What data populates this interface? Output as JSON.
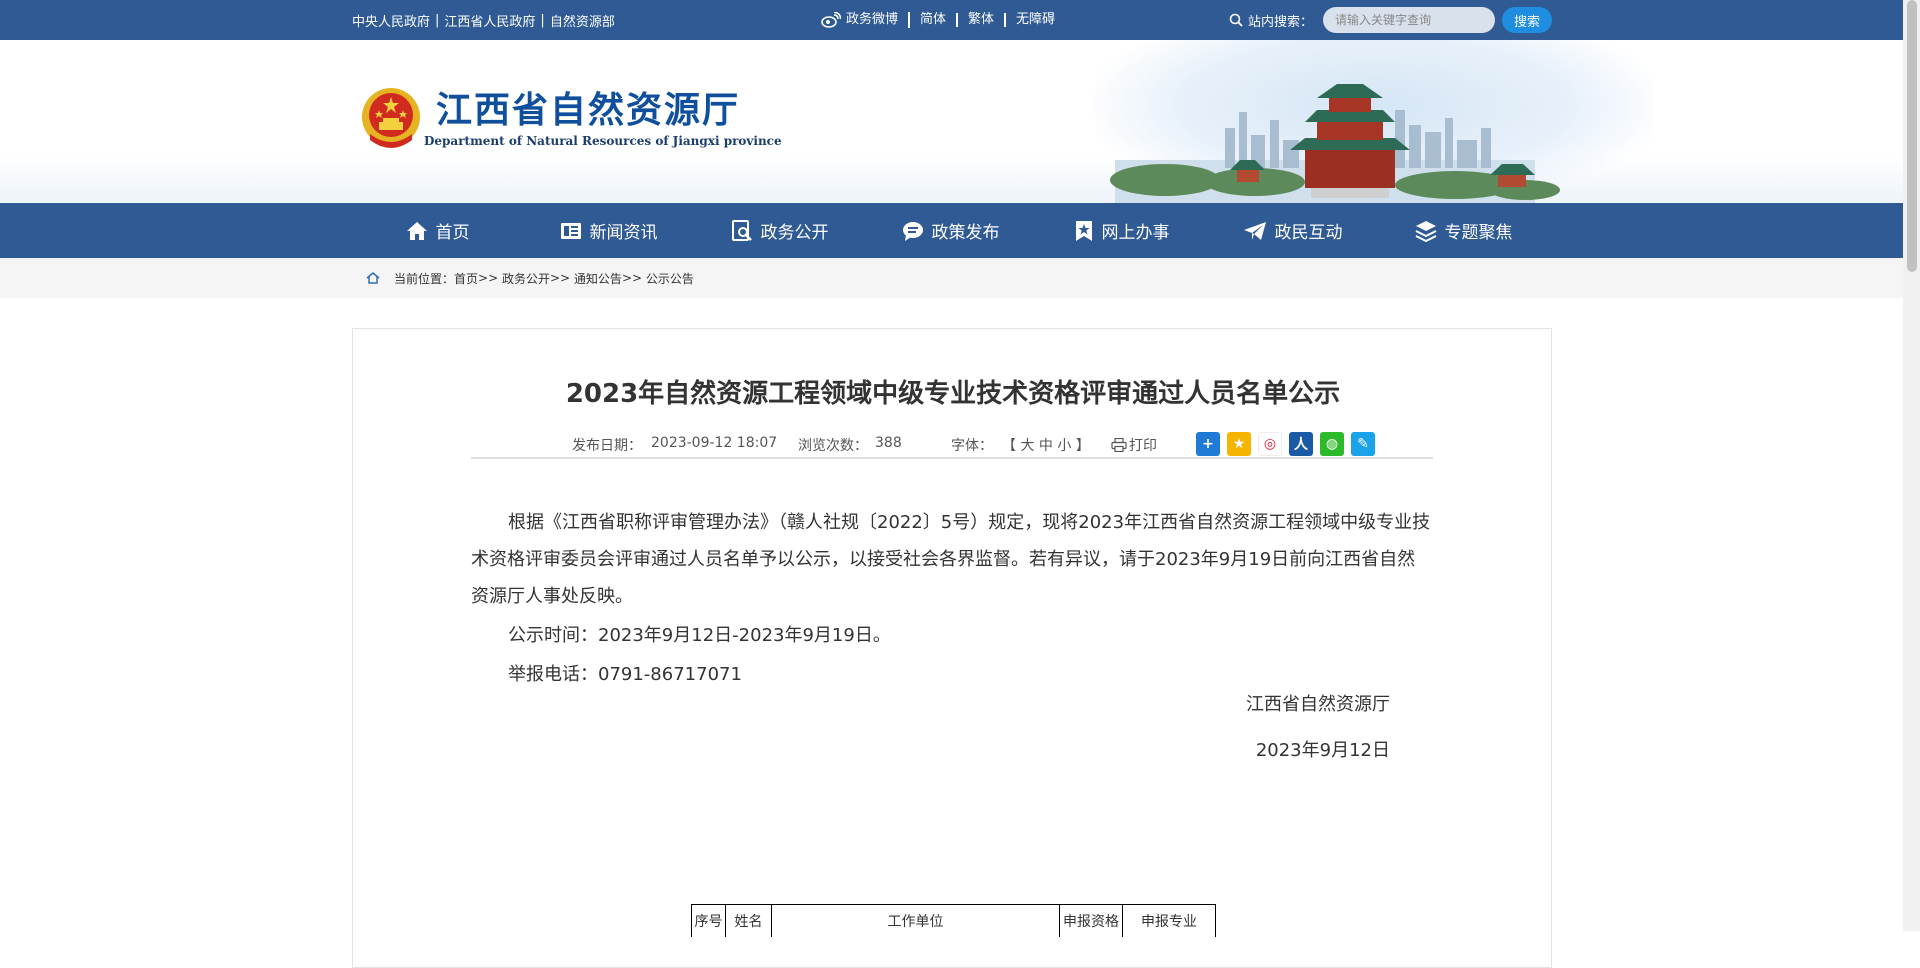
{
  "topbar": {
    "links": [
      "中央人民政府",
      "江西省人民政府",
      "自然资源部"
    ],
    "weibo": "政务微博",
    "simplified": "简体",
    "traditional": "繁体",
    "accessible": "无障碍",
    "search_label": "站内搜索：",
    "search_placeholder": "请输入关键字查询",
    "search_button": "搜索"
  },
  "header": {
    "title": "江西省自然资源厅",
    "subtitle": "Department of Natural Resources of Jiangxi province"
  },
  "nav": [
    {
      "label": "首页",
      "icon": "home-icon"
    },
    {
      "label": "新闻资讯",
      "icon": "news-icon"
    },
    {
      "label": "政务公开",
      "icon": "open-gov-icon"
    },
    {
      "label": "政策发布",
      "icon": "policy-icon"
    },
    {
      "label": "网上办事",
      "icon": "service-icon"
    },
    {
      "label": "政民互动",
      "icon": "interaction-icon"
    },
    {
      "label": "专题聚焦",
      "icon": "topics-icon"
    }
  ],
  "breadcrumb": {
    "prefix": "当前位置：",
    "items": [
      "首页",
      "政务公开",
      "通知公告",
      "公示公告"
    ]
  },
  "article": {
    "title": "2023年自然资源工程领域中级专业技术资格评审通过人员名单公示",
    "date_label": "发布日期：",
    "date": "2023-09-12 18:07",
    "views_label": "浏览次数：",
    "views": "388",
    "font_label": "字体：",
    "font_open": "【",
    "font_big": "大",
    "font_mid": "中",
    "font_small": "小",
    "font_close": "】",
    "print": "打印",
    "share_icons": [
      {
        "name": "share-more-icon",
        "color": "#1f7ad6",
        "glyph": "+"
      },
      {
        "name": "qzone-icon",
        "color": "#f4b400",
        "glyph": "★"
      },
      {
        "name": "weibo-share-icon",
        "color": "#e6162d",
        "glyph": "◎"
      },
      {
        "name": "renren-icon",
        "color": "#1b5ba6",
        "glyph": "人"
      },
      {
        "name": "wechat-icon",
        "color": "#2dba2a",
        "glyph": "◍"
      },
      {
        "name": "tqq-icon",
        "color": "#1aa3e8",
        "glyph": "✎"
      }
    ],
    "p1": "根据《江西省职称评审管理办法》（赣人社规〔2022〕5号）规定，现将2023年江西省自然资源工程领域中级专业技术资格评审委员会评审通过人员名单予以公示，以接受社会各界监督。若有异议，请于2023年9月19日前向江西省自然资源厅人事处反映。",
    "p2": "公示时间：2023年9月12日-2023年9月19日。",
    "p3": "举报电话：0791-86717071",
    "sign_org": "江西省自然资源厅",
    "sign_date": "2023年9月12日"
  },
  "table": {
    "headers": [
      "序号",
      "姓名",
      "工作单位",
      "申报资格",
      "申报专业"
    ]
  },
  "colors": {
    "brand": "#2f5a94",
    "title_blue": "#0f4f9b",
    "button_blue": "#1f8de0"
  }
}
